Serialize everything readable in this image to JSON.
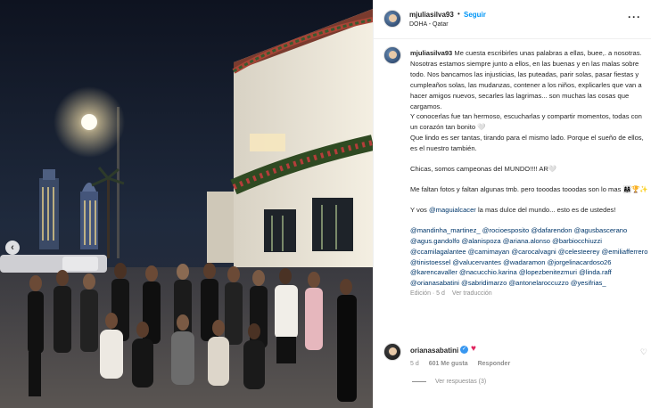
{
  "photo": {
    "description_icon": "group-photo",
    "prev_label": "‹"
  },
  "header": {
    "username": "mjuliasilva93",
    "dot": "•",
    "follow": "Seguir",
    "location": "DOHA - Qatar",
    "more": "···"
  },
  "caption": {
    "username": "mjuliasilva93",
    "p1": "Me cuesta escribirles unas palabras a ellas, buee,. a nosotras. Nosotras estamos siempre junto a ellos, en las buenas y en las malas sobre todo. Nos bancamos las injusticias, las puteadas, parir solas, pasar fiestas y cumpleaños solas, las mudanzas, contener a los niños, explicarles que van a hacer amigos nuevos, secarles las lagrimas... son muchas las cosas que cargamos.",
    "p2": "Y conocerlas fue tan hermoso, escucharlas y compartir momentos, todas con un corazón tan bonito 🤍",
    "p3": "Que lindo es ser tantas, tirando para el mismo lado. Porque el sueño de ellos, es el nuestro también.",
    "p4": "Chicas, somos campeonas del MUNDO!!!! AR🤍",
    "p5": "Me faltan fotos y faltan algunas tmb. pero tooodas tooodas son lo mas 👩‍👩‍👧🏆✨",
    "p6a": "Y vos ",
    "p6_tag": "@maguialcacer",
    "p6b": " la mas dulce del mundo... esto es de ustedes!",
    "tags": [
      "@mandinha_martinez_",
      "@rocioesposito",
      "@dafarendon",
      "@agusbascerano",
      "@agus.gandolfo",
      "@alanispoza",
      "@ariana.alonso",
      "@barbiocchiuzzi",
      "@ccamilagalantee",
      "@camimayan",
      "@carocalvagni",
      "@celesteerey",
      "@emiliafferrero",
      "@tinistoessel",
      "@valucervantes",
      "@wadaramon",
      "@jorgelinacardoso26",
      "@karencavaller",
      "@nacucchio.karina",
      "@lopezbenitezmuri",
      "@linda.raff",
      "@orianasabatini",
      "@sabridimarzo",
      "@antonelaroccuzzo",
      "@yesifrias_"
    ],
    "time": "Edición · 5 d",
    "translate": "Ver traducción"
  },
  "comment": {
    "username": "orianasabatini",
    "verified": "✓",
    "heart": "♥",
    "time": "5 d",
    "likes": "601 Me gusta",
    "reply": "Responder",
    "like_icon": "♡"
  },
  "replies": {
    "label": "Ver respuestas (3)"
  },
  "colors": {
    "link_blue": "#0095f6",
    "tag_blue": "#00376b",
    "muted": "#8e8e8e",
    "heart_red": "#e0245e"
  }
}
